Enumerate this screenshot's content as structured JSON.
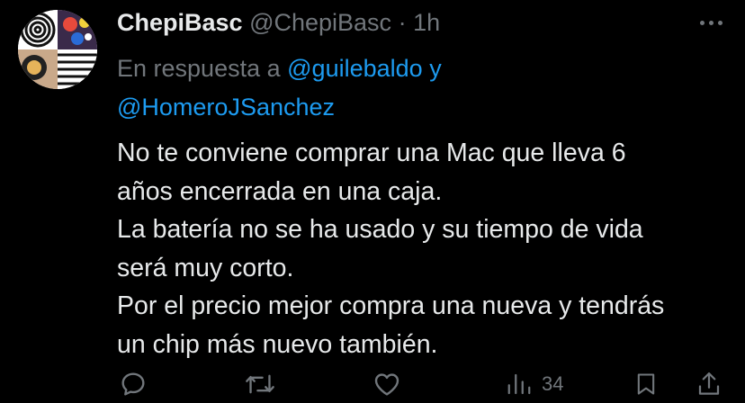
{
  "tweet": {
    "display_name": "ChepiBasc",
    "handle": "@ChepiBasc",
    "separator": "·",
    "time": "1h",
    "reply_prefix": "En respuesta a",
    "mention_1": "@guilebaldo",
    "reply_joiner": "y",
    "mention_2": "@HomeroJSanchez",
    "body_lines": [
      "No te conviene comprar una Mac que lleva 6",
      "años encerrada en una caja.",
      "La batería no se ha usado y su tiempo de vida",
      "será muy corto.",
      "Por el precio mejor compra una nueva y tendrás",
      "un chip más nuevo también."
    ]
  },
  "actions": {
    "views_count": "34"
  },
  "icons": [
    "reply-icon",
    "retweet-icon",
    "like-icon",
    "views-icon",
    "bookmark-icon",
    "share-icon",
    "more-icon"
  ],
  "colors": {
    "background": "#000000",
    "text": "#e7e9ea",
    "secondary": "#71767b",
    "accent": "#1d9bf0"
  }
}
